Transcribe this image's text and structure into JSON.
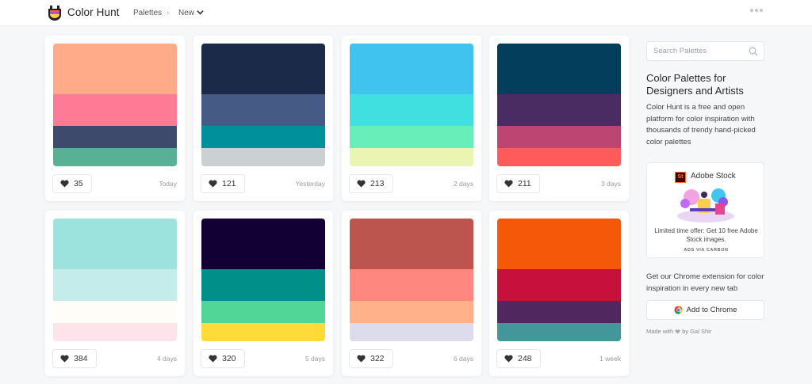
{
  "header": {
    "brand": "Color Hunt",
    "breadcrumb_palettes": "Palettes",
    "breadcrumb_sep": "›",
    "breadcrumb_current": "New"
  },
  "cards": [
    {
      "colors": [
        "#FFAB8A",
        "#FF7A95",
        "#3E4A6C",
        "#58B195"
      ],
      "likes": "35",
      "date": "Today"
    },
    {
      "colors": [
        "#1C2A4A",
        "#465A86",
        "#00909C",
        "#CBD0D3"
      ],
      "likes": "121",
      "date": "Yesterday"
    },
    {
      "colors": [
        "#40C3EE",
        "#40DFE0",
        "#68EFB9",
        "#EBF5B2"
      ],
      "likes": "213",
      "date": "2 days"
    },
    {
      "colors": [
        "#033F5C",
        "#4A2B62",
        "#BD4571",
        "#FF5B5B"
      ],
      "likes": "211",
      "date": "3 days"
    },
    {
      "colors": [
        "#9DE3DD",
        "#C3ECEA",
        "#FFFDF7",
        "#FFE3EB"
      ],
      "likes": "384",
      "date": "4 days"
    },
    {
      "colors": [
        "#120034",
        "#00908A",
        "#51D697",
        "#FFDB3A"
      ],
      "likes": "320",
      "date": "5 days"
    },
    {
      "colors": [
        "#BC554E",
        "#FE877F",
        "#FFB18A",
        "#DDDCEC"
      ],
      "likes": "322",
      "date": "6 days"
    },
    {
      "colors": [
        "#F6580A",
        "#C8103C",
        "#50275E",
        "#43969A"
      ],
      "likes": "248",
      "date": "1 week"
    }
  ],
  "sidebar": {
    "search_placeholder": "Search Palettes",
    "title": "Color Palettes for Designers and Artists",
    "description": "Color Hunt is a free and open platform for color inspiration with thousands of trendy hand-picked color palettes",
    "ad": {
      "logo_text": "St",
      "brand": "Adobe Stock",
      "text": "Limited time offer: Get 10 free Adobe Stock images.",
      "via": "ADS VIA CARBON"
    },
    "extension_text": "Get our Chrome extension for color inspiration in every new tab",
    "chrome_button": "Add to Chrome",
    "made_with_prefix": "Made with",
    "made_with_suffix": "by Gal Shir"
  }
}
